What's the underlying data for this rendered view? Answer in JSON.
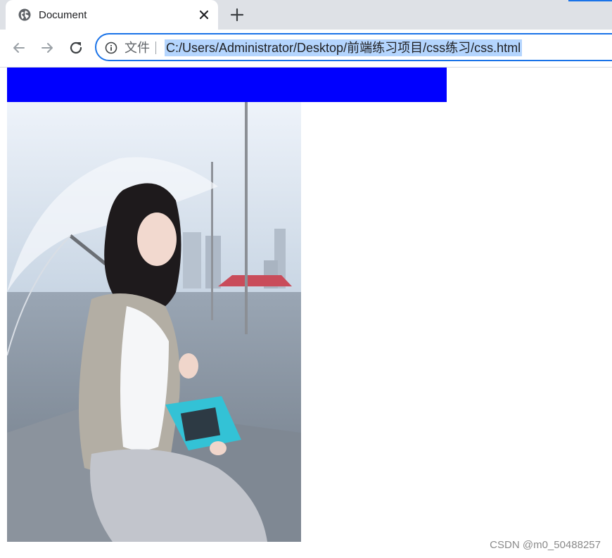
{
  "browser": {
    "tab": {
      "title": "Document",
      "favicon": "globe-icon",
      "close_icon": "close-icon"
    },
    "new_tab_icon": "plus-icon",
    "nav": {
      "back_icon": "arrow-left-icon",
      "forward_icon": "arrow-right-icon",
      "reload_icon": "reload-icon"
    },
    "omnibox": {
      "info_icon": "info-icon",
      "scheme_label": "文件",
      "url": "C:/Users/Administrator/Desktop/前端练习项目/css练习/css.html"
    },
    "colors": {
      "accent": "#1a73e8",
      "tabstrip": "#dee1e6",
      "selection": "#b4d5fe"
    }
  },
  "page": {
    "blue_box_color": "#0000ff",
    "photo_alt": "photo"
  },
  "watermark": "CSDN @m0_50488257"
}
